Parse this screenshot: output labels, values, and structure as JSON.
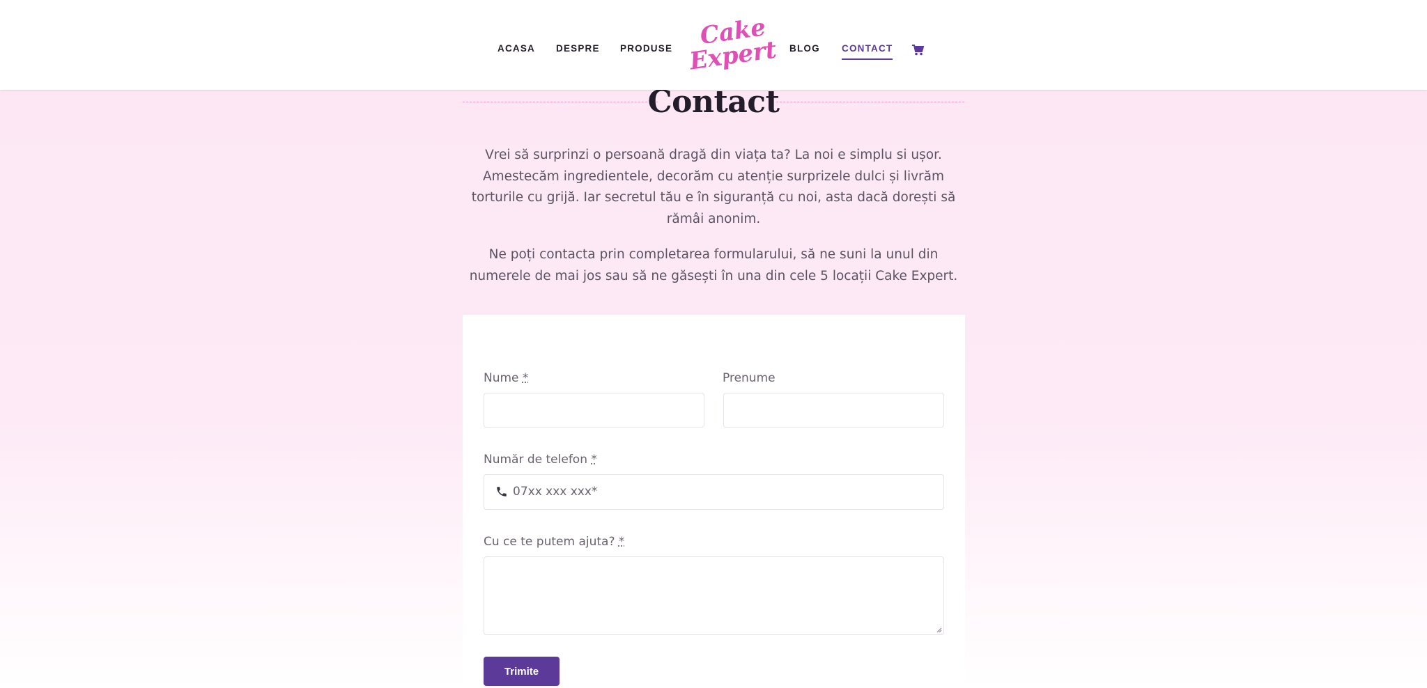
{
  "header": {
    "nav": [
      {
        "label": "ACASA"
      },
      {
        "label": "DESPRE"
      },
      {
        "label": "PRODUSE"
      },
      {
        "label": "BLOG"
      },
      {
        "label": "CONTACT",
        "active": true
      }
    ],
    "logo": {
      "line1": "Cake",
      "line2": "Expert"
    },
    "cart_icon": "shopping-cart-icon"
  },
  "page": {
    "title": "Contact",
    "intro": [
      "Vrei să surprinzi o persoană dragă din viața ta? La noi e simplu si ușor. Amestecăm ingredientele, decorăm cu atenție surprizele dulci și livrăm torturile cu grijă. Iar secretul tău e în siguranță cu noi, asta dacă dorești să rămâi anonim.",
      "Ne poți contacta prin completarea formularului, să ne suni la unul din numerele de mai jos sau să ne găsești în una din cele 5 locații Cake Expert."
    ]
  },
  "form": {
    "nume_label": "Nume",
    "required_mark": "*",
    "prenume_label": "Prenume",
    "telefon_label": "Număr de telefon",
    "telefon_placeholder": "07xx xxx xxx*",
    "telefon_icon": "phone-icon",
    "mesaj_label": "Cu ce te putem ajuta?",
    "submit_label": "Trimite"
  },
  "colors": {
    "accent": "#5b3a9a",
    "logo": "#e04fb5",
    "background": "#fde6f4"
  }
}
